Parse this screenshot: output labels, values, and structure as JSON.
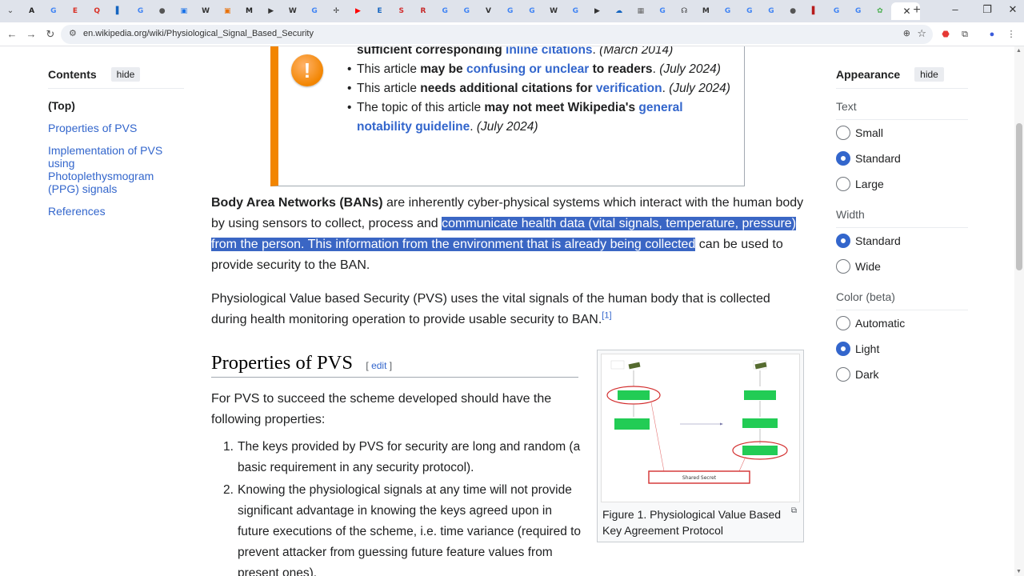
{
  "browser": {
    "tab_count_icons": [
      {
        "glyph": "A",
        "color": "#222222",
        "name": "text-icon"
      },
      {
        "glyph": "G",
        "color": "#4285f4",
        "name": "google-icon"
      },
      {
        "glyph": "E",
        "color": "#d93025",
        "name": "e-icon"
      },
      {
        "glyph": "Q",
        "color": "#d93025",
        "name": "q-icon"
      },
      {
        "glyph": "▌",
        "color": "#1565c0",
        "name": "doc-icon"
      },
      {
        "glyph": "G",
        "color": "#4285f4",
        "name": "google-icon"
      },
      {
        "glyph": "●",
        "color": "#555555",
        "name": "circle-icon"
      },
      {
        "glyph": "▣",
        "color": "#1a73e8",
        "name": "mail-icon"
      },
      {
        "glyph": "W",
        "color": "#333333",
        "name": "wikipedia-icon"
      },
      {
        "glyph": "▣",
        "color": "#e8710a",
        "name": "box-icon"
      },
      {
        "glyph": "M",
        "color": "#222222",
        "name": "m-icon"
      },
      {
        "glyph": "▶",
        "color": "#333333",
        "name": "play-icon"
      },
      {
        "glyph": "W",
        "color": "#333333",
        "name": "wikipedia-icon"
      },
      {
        "glyph": "G",
        "color": "#4285f4",
        "name": "google-icon"
      },
      {
        "glyph": "✢",
        "color": "#333333",
        "name": "cross-icon"
      },
      {
        "glyph": "▶",
        "color": "#ff0000",
        "name": "youtube-icon"
      },
      {
        "glyph": "E",
        "color": "#1565c0",
        "name": "e-icon"
      },
      {
        "glyph": "S",
        "color": "#d32f2f",
        "name": "s-icon"
      },
      {
        "glyph": "R",
        "color": "#c62828",
        "name": "r-icon"
      },
      {
        "glyph": "G",
        "color": "#4285f4",
        "name": "google-icon"
      },
      {
        "glyph": "G",
        "color": "#4285f4",
        "name": "google-icon"
      },
      {
        "glyph": "V",
        "color": "#333333",
        "name": "v-icon"
      },
      {
        "glyph": "G",
        "color": "#4285f4",
        "name": "google-icon"
      },
      {
        "glyph": "G",
        "color": "#4285f4",
        "name": "google-icon"
      },
      {
        "glyph": "W",
        "color": "#333333",
        "name": "wikipedia-icon"
      },
      {
        "glyph": "G",
        "color": "#4285f4",
        "name": "google-icon"
      },
      {
        "glyph": "▶",
        "color": "#333333",
        "name": "play-icon"
      },
      {
        "glyph": "☁",
        "color": "#1565c0",
        "name": "cloud-icon"
      },
      {
        "glyph": "▦",
        "color": "#666666",
        "name": "grid-icon"
      },
      {
        "glyph": "G",
        "color": "#4285f4",
        "name": "google-icon"
      },
      {
        "glyph": "☊",
        "color": "#333333",
        "name": "headset-icon"
      },
      {
        "glyph": "M",
        "color": "#333333",
        "name": "m-icon"
      },
      {
        "glyph": "G",
        "color": "#4285f4",
        "name": "google-icon"
      },
      {
        "glyph": "G",
        "color": "#4285f4",
        "name": "google-icon"
      },
      {
        "glyph": "G",
        "color": "#4285f4",
        "name": "google-icon"
      },
      {
        "glyph": "●",
        "color": "#555555",
        "name": "circle-icon"
      },
      {
        "glyph": "▌",
        "color": "#b71c1c",
        "name": "book-icon"
      },
      {
        "glyph": "G",
        "color": "#4285f4",
        "name": "google-icon"
      },
      {
        "glyph": "G",
        "color": "#4285f4",
        "name": "google-icon"
      },
      {
        "glyph": "✿",
        "color": "#4caf50",
        "name": "puzzle-icon"
      }
    ],
    "active_tab_close": "✕",
    "new_tab": "+",
    "url": "en.wikipedia.org/wiki/Physiological_Signal_Based_Security"
  },
  "toc": {
    "title": "Contents",
    "hide": "hide",
    "items": [
      "(Top)",
      "Properties of PVS",
      "Implementation of PVS using Photoplethysmogram (PPG) signals",
      "References"
    ]
  },
  "ambox": {
    "item1_bold_a": "sufficient corresponding ",
    "item1_link": "inline citations",
    "item1_date": "(March 2014)",
    "item2_pre": "This article ",
    "item2_bold_a": "may be ",
    "item2_link": "confusing or unclear",
    "item2_bold_b": " to readers",
    "item2_date": "(July 2024)",
    "item3_pre": "This article ",
    "item3_bold": "needs additional citations for ",
    "item3_link": "verification",
    "item3_date": "(July 2024)",
    "item4_pre": "The topic of this article ",
    "item4_bold": "may not meet Wikipedia's ",
    "item4_link": "general notability guideline",
    "item4_date": "(July 2024)"
  },
  "article": {
    "p1_bold": "Body Area Networks (BANs)",
    "p1_a": " are inherently cyber-physical systems which interact with the human body by using sensors to collect, process and ",
    "p1_selected": "communicate health data (vital signals, temperature, pressure) from the person. This information from the environment that is already being collected",
    "p1_b": " can be used to provide security to the BAN.",
    "p2": "Physiological Value based Security (PVS) uses the vital signals of the human body that is collected during health monitoring operation to provide usable security to BAN.",
    "p2_ref": "[1]",
    "h_props": "Properties of PVS",
    "edit_open": "[ ",
    "edit": "edit",
    "edit_close": " ]",
    "p3": "For PVS to succeed the scheme developed should have the following properties:",
    "list": [
      {
        "num": "1.",
        "text": "The keys provided by PVS for security are long and random (a basic requirement in any security protocol)."
      },
      {
        "num": "2.",
        "text": "Knowing the physiological signals at any time will not provide significant advantage in knowing the keys agreed upon in future executions of the scheme, i.e. time variance (required to prevent attacker from guessing future feature values from present ones)."
      }
    ],
    "figure_caption": "Figure 1. Physiological Value Based Key Agreement Protocol",
    "figure_shared_secret": "Shared Secret"
  },
  "appearance": {
    "title": "Appearance",
    "hide": "hide",
    "text_label": "Text",
    "text_options": [
      {
        "label": "Small",
        "checked": false
      },
      {
        "label": "Standard",
        "checked": true
      },
      {
        "label": "Large",
        "checked": false
      }
    ],
    "width_label": "Width",
    "width_options": [
      {
        "label": "Standard",
        "checked": true
      },
      {
        "label": "Wide",
        "checked": false
      }
    ],
    "color_label": "Color (beta)",
    "color_options": [
      {
        "label": "Automatic",
        "checked": false
      },
      {
        "label": "Light",
        "checked": true
      },
      {
        "label": "Dark",
        "checked": false
      }
    ]
  },
  "colors": {
    "link": "#3366cc",
    "selection": "#3a66c4",
    "ambox_accent": "#f28500",
    "radio_on": "#3366cc"
  }
}
